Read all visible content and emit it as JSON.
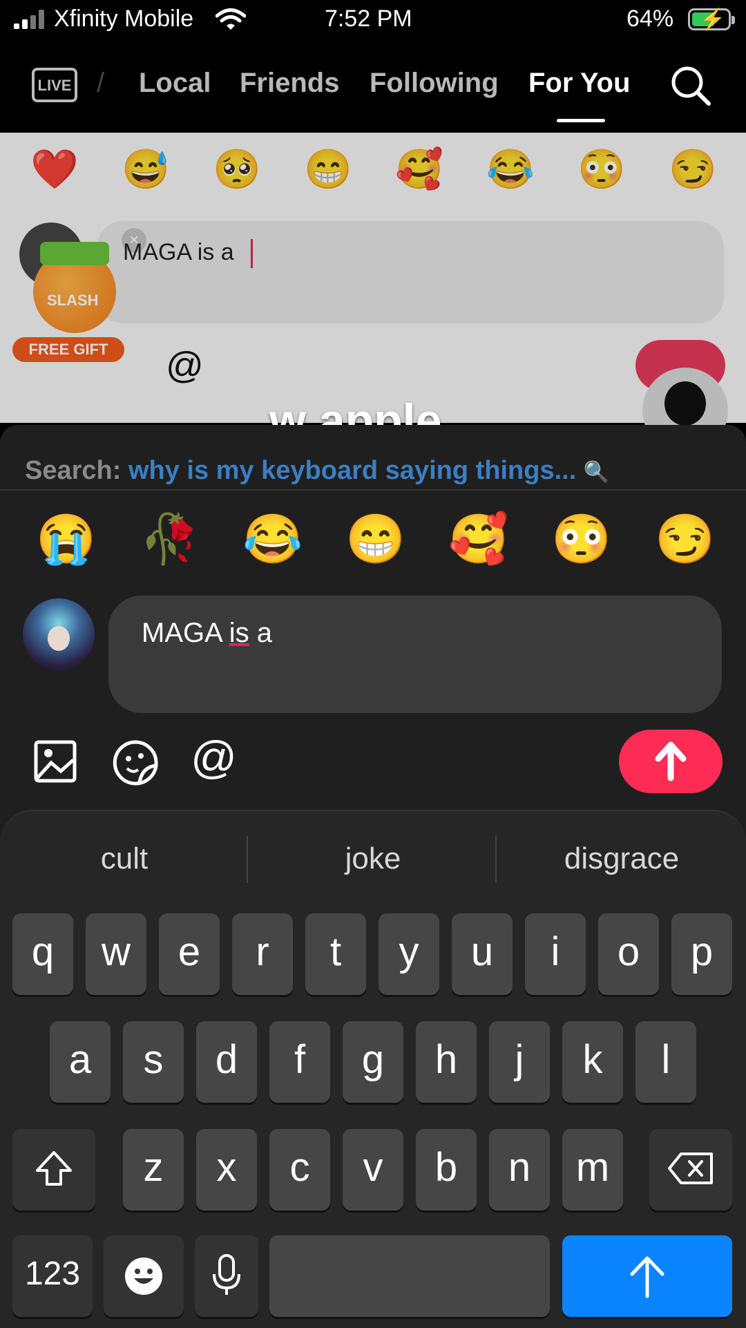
{
  "status_bar": {
    "carrier": "Xfinity Mobile",
    "time": "7:52 PM",
    "battery": "64%",
    "battery_level": 0.64,
    "icons": [
      "signal-icon",
      "wifi-icon",
      "battery-charging-icon"
    ]
  },
  "nav": {
    "live_label": "LIVE",
    "tabs": [
      {
        "label": "Local"
      },
      {
        "label": "Friends"
      },
      {
        "label": "Following"
      },
      {
        "label": "For You",
        "active": true
      }
    ]
  },
  "background_page": {
    "emojis": [
      "❤️",
      "😅",
      "🥺",
      "😁",
      "🥰",
      "😂",
      "😳",
      "😏"
    ],
    "comment_text": "MAGA is a",
    "gift_label": "SLASH",
    "free_gift_label": "FREE GIFT"
  },
  "caption": "w apple",
  "search_suggestion": {
    "prefix": "Search:",
    "query": "why is my keyboard saying things..."
  },
  "emoji_bar": [
    "😭",
    "🥀",
    "😂",
    "😁",
    "🥰",
    "😳",
    "😏"
  ],
  "comment": {
    "text_before": "MAGA ",
    "underlined": "is",
    "text_after": " a"
  },
  "predictions": [
    "cult",
    "joke",
    "disgrace"
  ],
  "keyboard": {
    "row1": [
      "q",
      "w",
      "e",
      "r",
      "t",
      "y",
      "u",
      "i",
      "o",
      "p"
    ],
    "row2": [
      "a",
      "s",
      "d",
      "f",
      "g",
      "h",
      "j",
      "k",
      "l"
    ],
    "row3": [
      "z",
      "x",
      "c",
      "v",
      "b",
      "n",
      "m"
    ],
    "numbers_label": "123"
  },
  "colors": {
    "accent_send": "#fe2c55",
    "keyboard_return": "#0a84ff",
    "search_link": "#3b7fc4"
  }
}
